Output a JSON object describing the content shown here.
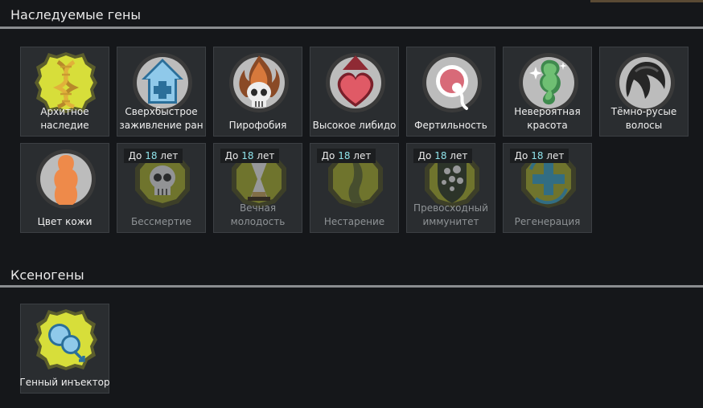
{
  "sections": {
    "inherited": {
      "title": "Наследуемые гены"
    },
    "xeno": {
      "title": "Ксеногены"
    }
  },
  "age_tag": {
    "prefix": "До",
    "number": "18",
    "suffix": "лет"
  },
  "genes": [
    {
      "label": "Архитное\nнаследие",
      "icon": "dna-icon"
    },
    {
      "label": "Сверхбыстрое\nзаживление ран",
      "icon": "house-plus-icon"
    },
    {
      "label": "Пирофобия",
      "icon": "flaming-skull-icon"
    },
    {
      "label": "Высокое либидо",
      "icon": "heart-arrow-icon"
    },
    {
      "label": "Фертильность",
      "icon": "egg-sperm-icon"
    },
    {
      "label": "Невероятная\nкрасота",
      "icon": "sparkle-figure-icon"
    },
    {
      "label": "Тёмно-русые\nволосы",
      "icon": "hair-icon"
    },
    {
      "label": "Цвет кожи",
      "icon": "body-silhouette-icon"
    },
    {
      "label": "Бессмертие",
      "icon": "skull-icon"
    },
    {
      "label": "Вечная\nмолодость",
      "icon": "hourglass-icon"
    },
    {
      "label": "Нестарение",
      "icon": "leaf-arm-icon"
    },
    {
      "label": "Превосходный\nиммунитет",
      "icon": "shield-cells-icon"
    },
    {
      "label": "Регенерация",
      "icon": "cross-arrows-icon"
    }
  ],
  "xenogenes": [
    {
      "label": "Генный инъектор",
      "icon": "gene-injector-icon"
    }
  ]
}
